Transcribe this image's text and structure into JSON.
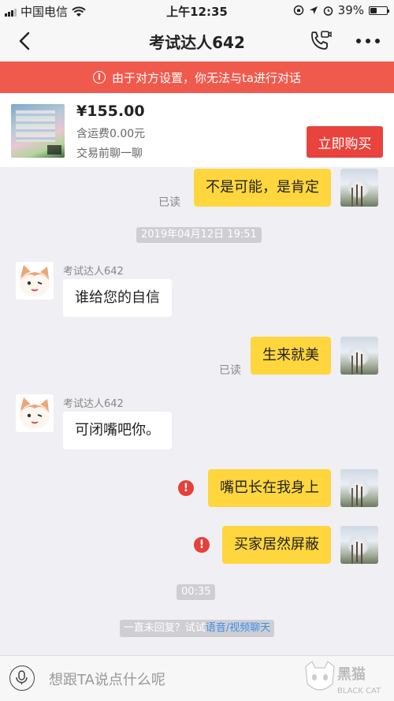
{
  "status_bar": {
    "carrier": "中国电信",
    "time": "上午12:35",
    "battery": "39%",
    "battery_level": 0.39
  },
  "nav": {
    "title": "考试达人642",
    "back_icon": "chevron-left-icon",
    "call_icon": "phone-video-icon",
    "more_icon": "more-dots-icon"
  },
  "notice": {
    "text": "由于对方设置，你无法与ta进行对话",
    "icon": "info-icon",
    "color": "#f05a4d"
  },
  "product": {
    "price": "¥155.00",
    "shipping": "含运费0.00元",
    "chat_hint": "交易前聊一聊",
    "buy_label": "立即购买",
    "buy_color": "#e8433c"
  },
  "chat": {
    "messages": [
      {
        "from": "me",
        "text": "不是可能，是肯定",
        "read": "已读"
      },
      {
        "timestamp": "2019年04月12日 19:51"
      },
      {
        "from": "them",
        "sender": "考试达人642",
        "text": "谁给您的自信"
      },
      {
        "from": "me",
        "text": "生来就美",
        "read": "已读"
      },
      {
        "from": "them",
        "sender": "考试达人642",
        "text": "可闭嘴吧你。"
      },
      {
        "from": "me",
        "text": "嘴巴长在我身上",
        "failed": true
      },
      {
        "from": "me",
        "text": "买家居然屏蔽",
        "failed": true
      },
      {
        "timestamp": "00:35"
      }
    ],
    "hint": {
      "prefix": "一直未回复？试试",
      "link_voice": "语音",
      "separator": "/",
      "link_video": "视频聊天"
    },
    "my_bubble_color": "#ffd63e"
  },
  "input": {
    "placeholder": "想跟TA说点什么呢",
    "mic_icon": "microphone-icon"
  },
  "watermark": {
    "text": "黑猫",
    "subtext": "BLACK CAT"
  }
}
